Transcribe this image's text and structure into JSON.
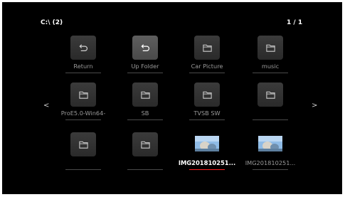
{
  "header": {
    "path": "C:\\ (2)",
    "page_indicator": "1 / 1"
  },
  "nav": {
    "prev_glyph": "<",
    "next_glyph": ">"
  },
  "grid": {
    "items": [
      {
        "label": "Return",
        "icon": "return-icon"
      },
      {
        "label": "Up Folder",
        "icon": "up-folder-icon"
      },
      {
        "label": "Car Picture",
        "icon": "folder-icon"
      },
      {
        "label": "music",
        "icon": "folder-icon"
      },
      {
        "label": "ProE5.0-Win64-",
        "icon": "folder-icon"
      },
      {
        "label": "SB",
        "icon": "folder-icon"
      },
      {
        "label": "TVSB SW",
        "icon": "folder-icon"
      },
      {
        "label": "",
        "icon": "folder-icon"
      },
      {
        "label": "",
        "icon": "folder-icon"
      },
      {
        "label": "",
        "icon": "folder-icon"
      },
      {
        "label": "IMG201810251...",
        "icon": "image-thumbnail"
      },
      {
        "label": "IMG201810251...",
        "icon": "image-thumbnail"
      }
    ],
    "selected_index": 1,
    "focused_index": 10
  },
  "colors": {
    "focus_underline": "#ff2020",
    "background": "#000000",
    "tile": "#333333"
  }
}
